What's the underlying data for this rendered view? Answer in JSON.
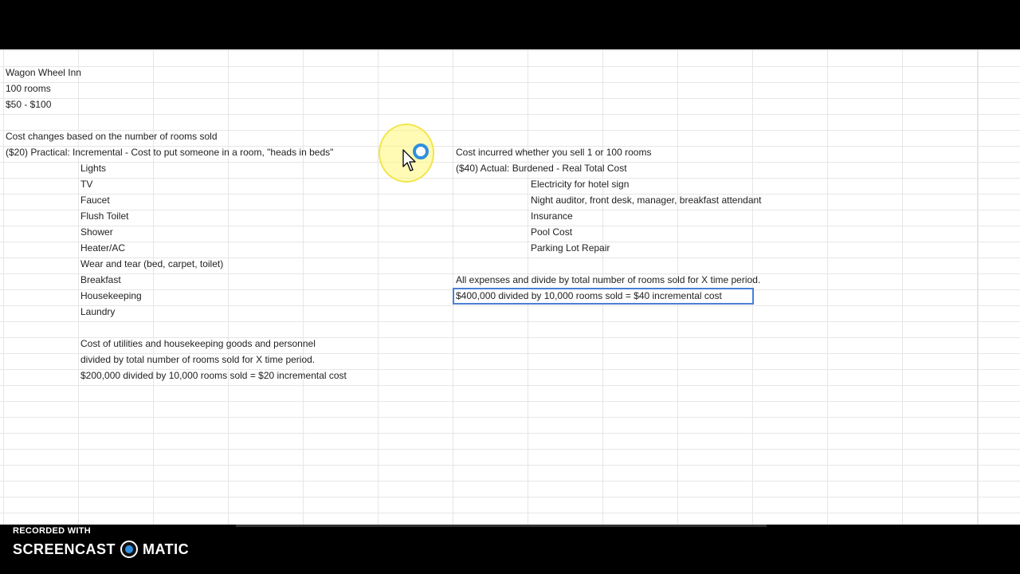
{
  "sheet": {
    "col_a": {
      "r0": "Wagon Wheel Inn",
      "r1": "100 rooms",
      "r2": "$50 - $100",
      "r4": "Cost changes based on the number of rooms sold",
      "r5": "($20) Practical: Incremental - Cost to put someone in a room, \"heads in beds\""
    },
    "col_b": {
      "r6": "Lights",
      "r7": "TV",
      "r8": "Faucet",
      "r9": "Flush Toilet",
      "r10": "Shower",
      "r11": "Heater/AC",
      "r12": "Wear and tear (bed, carpet, toilet)",
      "r13": "Breakfast",
      "r14": "Housekeeping",
      "r15": "Laundry",
      "r17": "Cost of utilities and housekeeping goods and personnel",
      "r18": "divided by total number of rooms sold for X time period.",
      "r19": "$200,000 divided by 10,000 rooms sold = $20 incremental cost"
    },
    "col_g": {
      "r5": "Cost incurred whether you sell 1 or 100 rooms",
      "r6": "($40) Actual: Burdened - Real Total Cost",
      "r13": "All expenses and divide by total number of rooms sold for X time period.",
      "r14": "$400,000 divided by 10,000 rooms sold = $40 incremental cost"
    },
    "col_h": {
      "r7": "Electricity for hotel sign",
      "r8": "Night auditor, front desk, manager, breakfast attendant",
      "r9": "Insurance",
      "r10": "Pool Cost",
      "r11": "Parking Lot Repair"
    }
  },
  "watermark": {
    "recorded_with": "RECORDED WITH",
    "brand_left": "SCREENCAST",
    "brand_right": "MATIC"
  },
  "colors": {
    "selection_border": "#4a7fd6",
    "cursor_highlight": "#fff878",
    "click_ring": "#2f8fe0"
  }
}
